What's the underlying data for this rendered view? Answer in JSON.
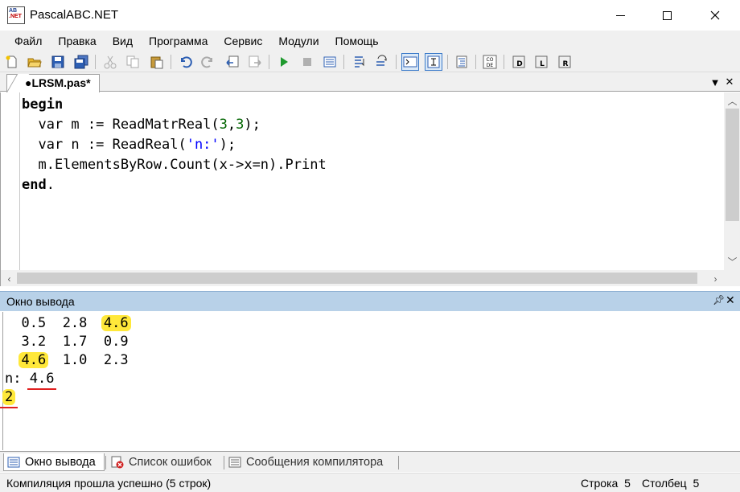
{
  "window": {
    "title": "PascalABC.NET",
    "icon_text_1": "AB",
    "icon_text_2": ".NET"
  },
  "menu": [
    "Файл",
    "Правка",
    "Вид",
    "Программа",
    "Сервис",
    "Модули",
    "Помощь"
  ],
  "toolbar_icons": [
    "new-file-icon",
    "open-folder-icon",
    "save-icon",
    "save-all-icon",
    "cut-icon",
    "copy-icon",
    "paste-icon",
    "undo-icon",
    "redo-icon",
    "navigate-back-icon",
    "navigate-forward-icon",
    "run-icon",
    "stop-icon",
    "compile-icon",
    "debug-step-into-icon",
    "debug-step-over-icon",
    "console-icon",
    "text-format-icon",
    "format-code-icon",
    "code-template-icon",
    "doc-d-icon",
    "doc-l-icon",
    "doc-r-icon"
  ],
  "editor": {
    "tab_label": "●LRSM.pas*",
    "lines": [
      {
        "kw": "begin"
      },
      {
        "pre": "  var m := ReadMatrReal(",
        "n1": "3",
        "c": ",",
        "n2": "3",
        "post": ");"
      },
      {
        "pre": "  var n := ReadReal(",
        "s": "'n:'",
        "post": ");"
      },
      {
        "plain": "  m.ElementsByRow.Count(x->x=n).Print"
      },
      {
        "kw": "end",
        "post": "."
      }
    ]
  },
  "output": {
    "title": "Окно вывода",
    "rows": [
      [
        "0.5",
        "2.8",
        "4.6"
      ],
      [
        "3.2",
        "1.7",
        "0.9"
      ],
      [
        "4.6",
        "1.0",
        "2.3"
      ]
    ],
    "prompt": "n:",
    "input_value": "4.6",
    "result": "2"
  },
  "bottom_tabs": [
    {
      "label": "Окно вывода",
      "icon": "output-window-icon"
    },
    {
      "label": "Список ошибок",
      "icon": "error-list-icon"
    },
    {
      "label": "Сообщения компилятора",
      "icon": "compiler-messages-icon"
    }
  ],
  "status": {
    "message": "Компиляция прошла успешно (5 строк)",
    "row_label": "Строка",
    "row_value": "5",
    "col_label": "Столбец",
    "col_value": "5"
  }
}
